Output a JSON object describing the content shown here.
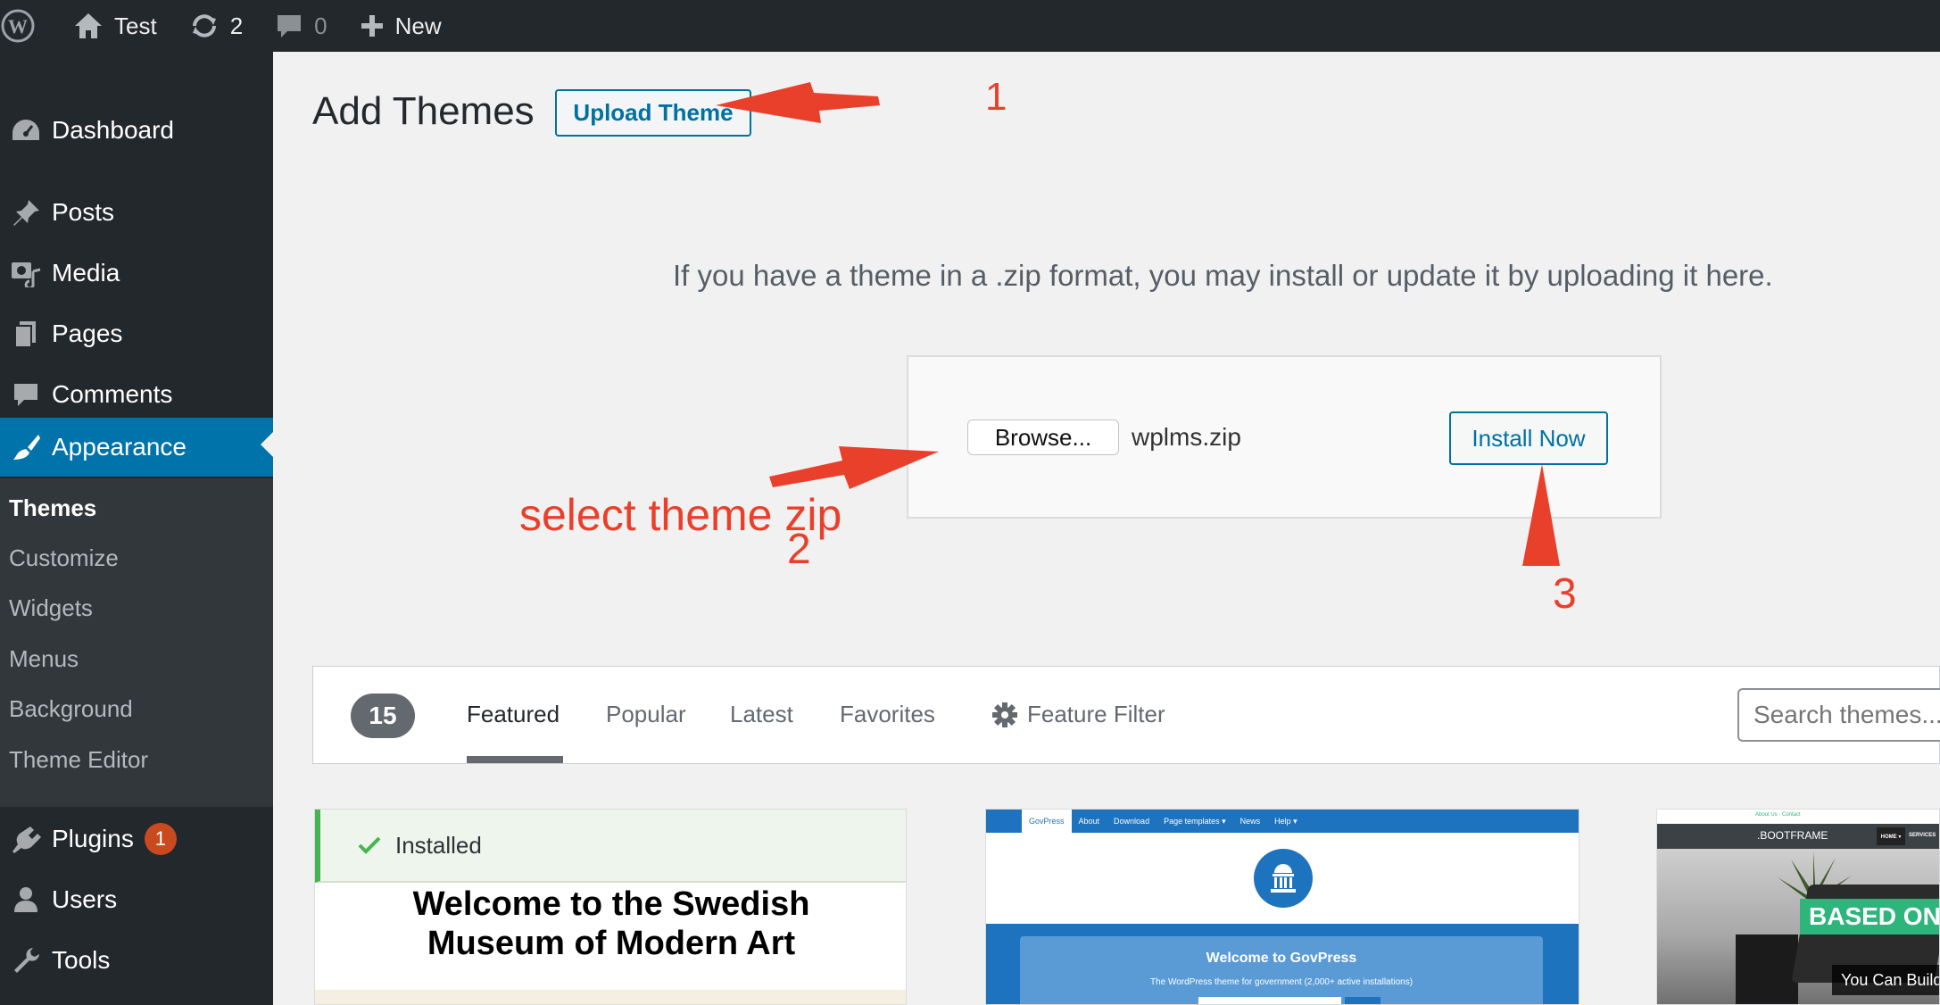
{
  "adminbar": {
    "site_name": "Test",
    "updates_count": "2",
    "comments_count": "0",
    "new_label": "New"
  },
  "sidebar": {
    "dashboard": "Dashboard",
    "posts": "Posts",
    "media": "Media",
    "pages": "Pages",
    "comments": "Comments",
    "appearance": "Appearance",
    "submenu": [
      "Themes",
      "Customize",
      "Widgets",
      "Menus",
      "Background",
      "Theme Editor"
    ],
    "plugins": "Plugins",
    "plugins_badge": "1",
    "users": "Users",
    "tools": "Tools"
  },
  "main": {
    "title": "Add Themes",
    "upload_button": "Upload Theme",
    "upload_help": "If you have a theme in a .zip format, you may install or update it by uploading it here.",
    "browse_button": "Browse...",
    "file_name": "wplms.zip",
    "install_button": "Install Now"
  },
  "filter": {
    "count": "15",
    "tabs": [
      "Featured",
      "Popular",
      "Latest",
      "Favorites"
    ],
    "active_tab": "Featured",
    "feature_filter": "Feature Filter",
    "search_placeholder": "Search themes..."
  },
  "themes": {
    "card1": {
      "installed_label": "Installed",
      "heading_line1": "Welcome to the Swedish",
      "heading_line2": "Museum of Modern Art"
    },
    "card2": {
      "nav": [
        "GovPress",
        "About",
        "Download",
        "Page templates ▾",
        "News",
        "Help ▾"
      ],
      "hero_title": "Welcome to GovPress",
      "hero_sub": "The WordPress theme for government (2,000+ active installations)"
    },
    "card3": {
      "topline": "About Us  ·  Contact",
      "logo": ".BOOTFRAME",
      "nav_home": "HOME ▾",
      "nav_services": "SERVICES",
      "banner": "BASED ON",
      "sub": "You Can Build"
    }
  },
  "annotations": {
    "step1": "1",
    "step2": "2",
    "step2_label": "select theme zip",
    "step3": "3",
    "color": "#e8402b"
  },
  "colors": {
    "adminbar_bg": "#23282d",
    "accent": "#0073aa",
    "button_blue": "#0071a1",
    "installed_green": "#46b450",
    "badge_orange": "#ca4a1f"
  }
}
